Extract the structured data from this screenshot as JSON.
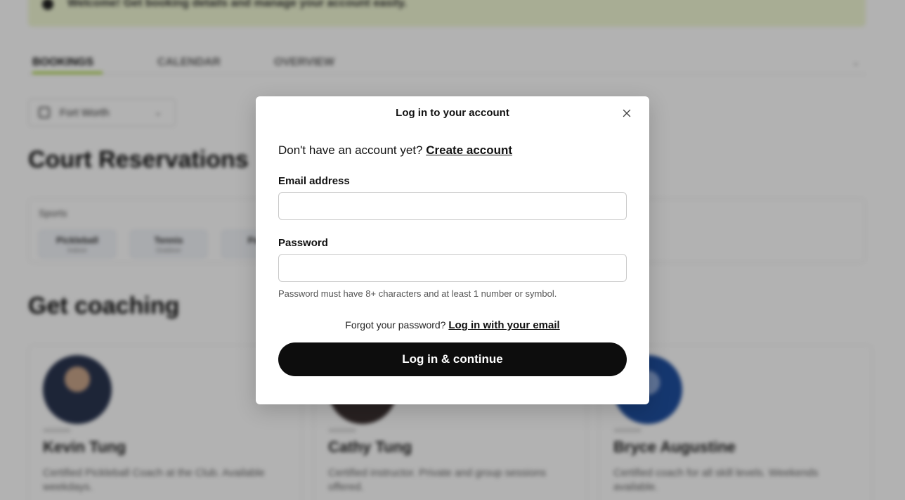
{
  "background": {
    "banner_text": "Welcome! Get booking details and manage your account easily.",
    "tabs": [
      "BOOKINGS",
      "CALENDAR",
      "OVERVIEW"
    ],
    "location_button": "Fort Worth",
    "court_heading": "Court Reservations",
    "sports_label": "Sports",
    "sports": [
      {
        "name": "Pickleball",
        "sub": "Indoor"
      },
      {
        "name": "Tennis",
        "sub": "Outdoor"
      },
      {
        "name": "Padel",
        "sub": ""
      }
    ],
    "coaching_heading": "Get coaching",
    "coaches": [
      {
        "name": "Kevin Tung",
        "desc": "Certified Pickleball Coach at the Club. Available weekdays."
      },
      {
        "name": "Cathy Tung",
        "desc": "Certified instructor. Private and group sessions offered."
      },
      {
        "name": "Bryce Augustine",
        "desc": "Certified coach for all skill levels. Weekends available."
      }
    ]
  },
  "modal": {
    "title": "Log in to your account",
    "signup_prompt": "Don't have an account yet?",
    "signup_link": "Create account",
    "email_label": "Email address",
    "email_value": "",
    "password_label": "Password",
    "password_value": "",
    "password_hint": "Password must have 8+ characters and at least 1 number or symbol.",
    "forgot_prompt": "Forgot your password?",
    "forgot_link": "Log in with your email",
    "submit_label": "Log in & continue"
  },
  "colors": {
    "accent_green": "#9ed11c",
    "button_dark": "#0d0d0d",
    "overlay": "rgba(0,0,0,0.30)"
  },
  "icons": {
    "close": "close-icon"
  }
}
